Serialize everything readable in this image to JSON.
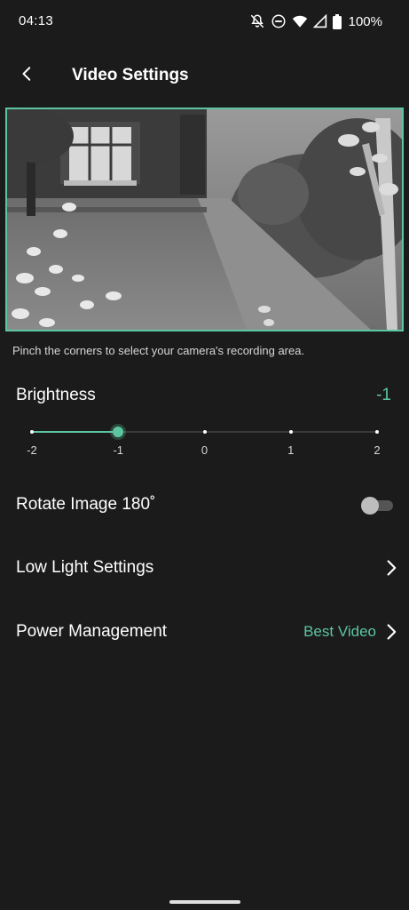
{
  "status_bar": {
    "time": "04:13",
    "battery": "100%",
    "icons": [
      "notifications-off-icon",
      "do-not-disturb-icon",
      "wifi-icon",
      "signal-icon",
      "battery-icon"
    ]
  },
  "header": {
    "title": "Video Settings",
    "back_icon": "back-arrow-icon"
  },
  "camera": {
    "instruction": "Pinch the corners to select your camera's recording area.",
    "border_color": "#5cc6a0"
  },
  "brightness": {
    "label": "Brightness",
    "value": "-1",
    "current": -1,
    "min": -2,
    "max": 2,
    "ticks": [
      "-2",
      "-1",
      "0",
      "1",
      "2"
    ]
  },
  "rotate": {
    "label": "Rotate Image 180˚",
    "enabled": false
  },
  "low_light": {
    "label": "Low Light Settings"
  },
  "power": {
    "label": "Power Management",
    "value": "Best Video"
  },
  "colors": {
    "accent": "#5cc6a0",
    "background": "#1b1b1b",
    "text": "#ffffff"
  }
}
